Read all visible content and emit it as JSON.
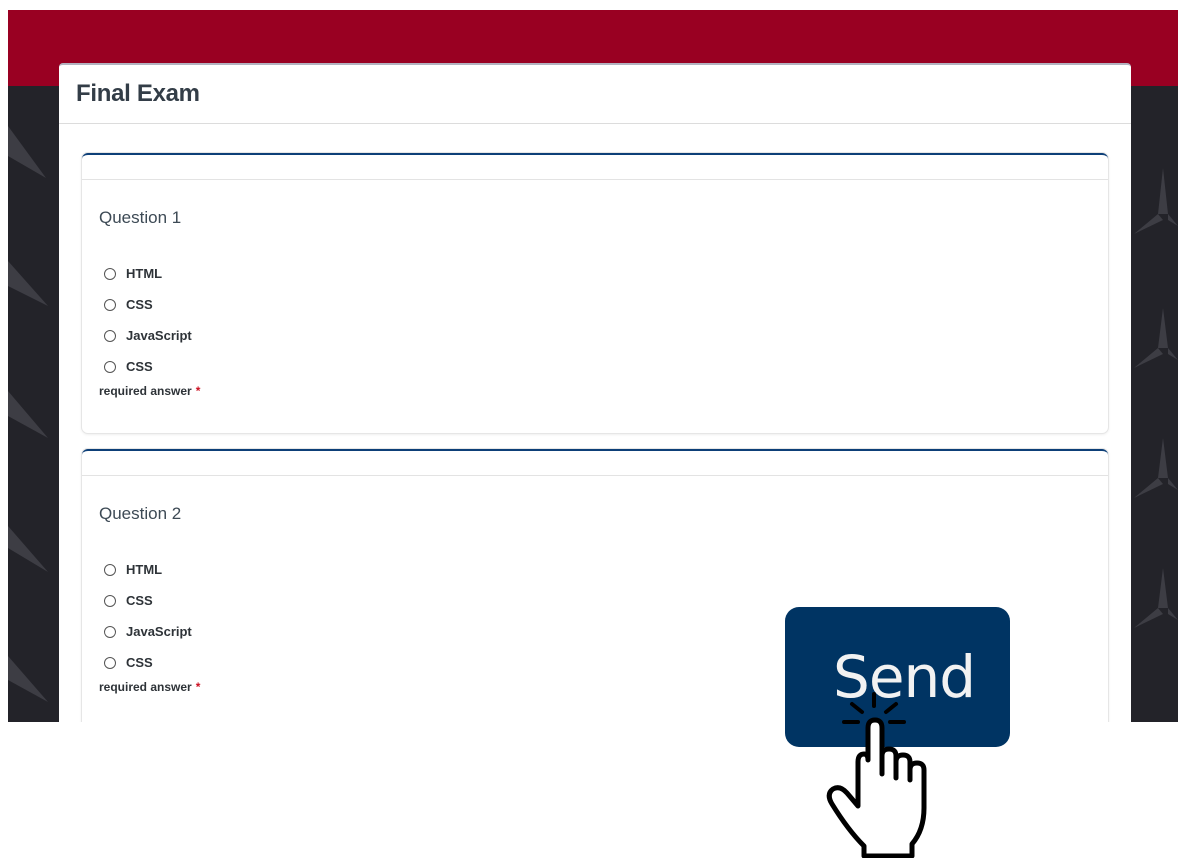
{
  "exam": {
    "title": "Final Exam"
  },
  "questions": [
    {
      "title": "Question 1",
      "options": [
        "HTML",
        "CSS",
        "JavaScript",
        "CSS"
      ],
      "required_label": "required answer",
      "required_mark": "*"
    },
    {
      "title": "Question 2",
      "options": [
        "HTML",
        "CSS",
        "JavaScript",
        "CSS"
      ],
      "required_label": "required answer",
      "required_mark": "*"
    }
  ],
  "send_button": {
    "label": "Send"
  },
  "icons": {
    "pointer": "hand-pointer-icon",
    "click": "click-burst-icon"
  },
  "colors": {
    "banner": "#990022",
    "background": "#232329",
    "question_accent": "#0d3f78",
    "send_button": "#003463",
    "required_mark": "#cc1122"
  }
}
